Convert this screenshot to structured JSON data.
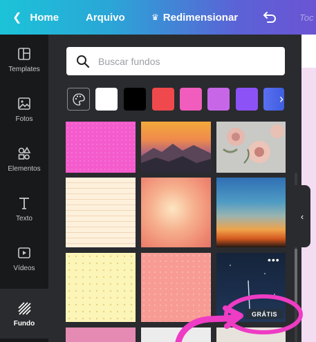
{
  "topbar": {
    "home_label": "Home",
    "arquivo_label": "Arquivo",
    "resize_label": "Redimensionar",
    "faded_label": "Toc"
  },
  "rail": {
    "items": [
      {
        "label": "Templates",
        "icon": "templates-icon"
      },
      {
        "label": "Fotos",
        "icon": "photos-icon"
      },
      {
        "label": "Elementos",
        "icon": "elements-icon"
      },
      {
        "label": "Texto",
        "icon": "text-icon"
      },
      {
        "label": "Vídeos",
        "icon": "video-icon"
      },
      {
        "label": "Fundo",
        "icon": "background-icon",
        "active": true
      }
    ]
  },
  "search": {
    "placeholder": "Buscar fundos"
  },
  "swatches": [
    "#ffffff",
    "#000000",
    "#f0494d",
    "#f15dbd",
    "#c767e8",
    "#8c52f6",
    "#5a6ff0"
  ],
  "badge": {
    "label": "GRÁTIS"
  },
  "colors": {
    "accent_gradient_start": "#1cc3d8",
    "accent_gradient_end": "#6b54d4",
    "rail_bg": "#18191b",
    "panel_bg": "#2a2b2e",
    "annotation_pink": "#ee3cc4"
  }
}
